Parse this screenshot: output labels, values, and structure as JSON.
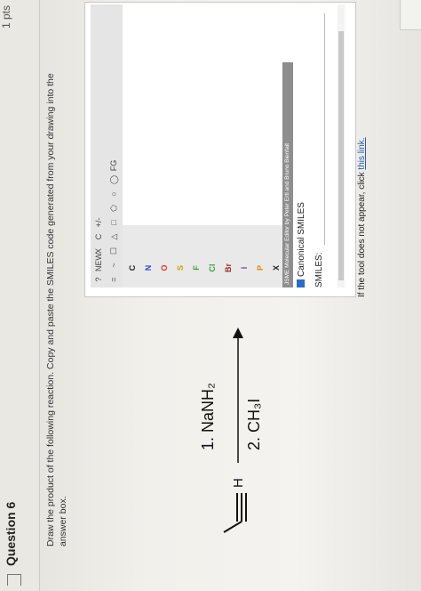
{
  "question": {
    "title": "Question 6",
    "points": "1 pts",
    "prompt": "Draw the product of the following reaction. Copy and paste the SMILES code generated from your drawing into the answer box."
  },
  "reaction": {
    "h_label": "H",
    "reagent_1": "1. NaNH₂",
    "reagent_2": "2. CH₃I"
  },
  "editor": {
    "toolbar": [
      "?",
      "NEW",
      "X",
      "C",
      "+/-",
      "=",
      "~",
      "☐",
      "△",
      "□",
      "⬠",
      "○",
      "◯",
      "FG"
    ],
    "atoms": [
      "C",
      "N",
      "O",
      "S",
      "F",
      "Cl",
      "Br",
      "I",
      "P",
      "X"
    ],
    "atom_colors": [
      "#222222",
      "#2a4fd0",
      "#e03131",
      "#c9a400",
      "#3aa53a",
      "#3aa53a",
      "#a52a2a",
      "#8b3db8",
      "#e08a00",
      "#222222"
    ],
    "credit": "JSME Molecular Editor by Peter Ertl and Bruno Bienfait",
    "canonical_label": "Canonical SMILES",
    "smiles_label": "SMILES:",
    "smiles_value": ""
  },
  "footer": {
    "note": "If the tool does not appear, click ",
    "link": "this link."
  }
}
